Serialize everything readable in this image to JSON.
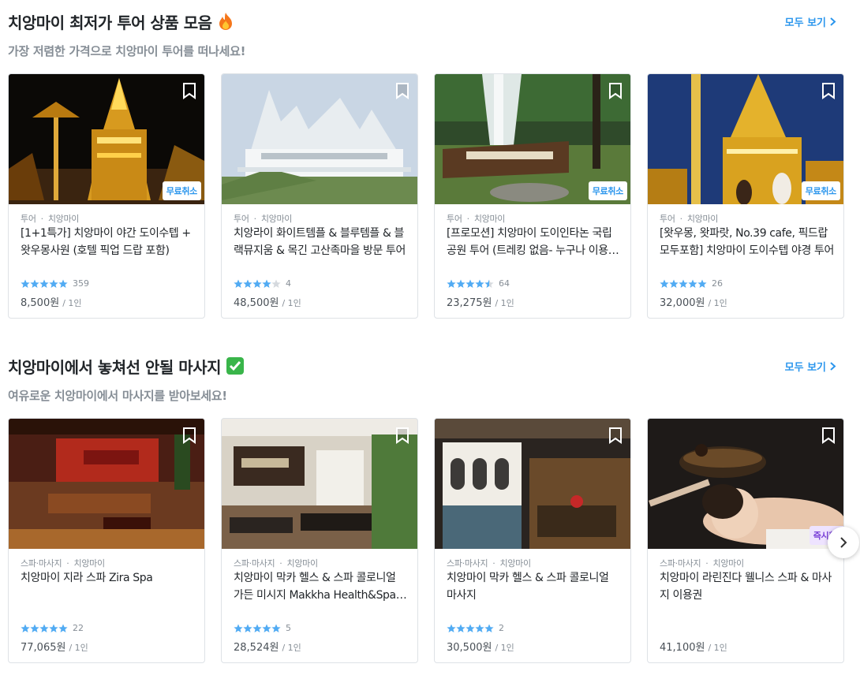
{
  "sections": [
    {
      "title": "치앙마이 최저가 투어 상품 모음",
      "title_icon": "fire-emoji",
      "subtitle": "가장 저렴한 가격으로 치앙마이 투어를 떠나세요!",
      "see_all": "모두 보기",
      "cards": [
        {
          "category": "투어",
          "city": "치앙마이",
          "title": "[1+1특가] 치앙마이 야간 도이수텝 + 왓우몽사원 (호텔 픽업 드랍 포함)",
          "rating": 5,
          "reviews": "359",
          "price": "8,500원",
          "unit": "/ 1인",
          "badge": "무료취소",
          "image": "golden-temple-night"
        },
        {
          "category": "투어",
          "city": "치앙마이",
          "title": "치앙라이 화이트템플 & 블루템플 & 블랙뮤지움 & 목긴 고산족마을 방문 투어",
          "rating": 4,
          "reviews": "4",
          "price": "48,500원",
          "unit": "/ 1인",
          "badge": "",
          "image": "white-temple"
        },
        {
          "category": "투어",
          "city": "치앙마이",
          "title": "[프로모션] 치앙마이 도이인타논 국립 공원 투어 (트레킹 없음- 누구나 이용 가능)",
          "rating": 4.5,
          "reviews": "64",
          "price": "23,275원",
          "unit": "/ 1인",
          "badge": "무료취소",
          "image": "waterfall"
        },
        {
          "category": "투어",
          "city": "치앙마이",
          "title": "[왓우몽, 왓파랏, No.39 cafe, 픽드랍 모두포함] 치앙마이 도이수텝 야경 투어",
          "rating": 5,
          "reviews": "26",
          "price": "32,000원",
          "unit": "/ 1인",
          "badge": "무료취소",
          "image": "golden-pagoda"
        }
      ]
    },
    {
      "title": "치앙마이에서 놓쳐선 안될 마사지",
      "title_icon": "check-emoji",
      "subtitle": "여유로운 치앙마이에서 마사지를 받아보세요!",
      "see_all": "모두 보기",
      "cards": [
        {
          "category": "스파·마사지",
          "city": "치앙마이",
          "title": "치앙마이 지라 스파 Zira Spa",
          "rating": 5,
          "reviews": "22",
          "price": "77,065원",
          "unit": "/ 1인",
          "badge": "",
          "image": "zira-spa-lobby"
        },
        {
          "category": "스파·마사지",
          "city": "치앙마이",
          "title": "치앙마이 막카 헬스 & 스파 콜로니얼 가든 미시지 Makkha Health&Spa Colonial Garden",
          "rating": 5,
          "reviews": "5",
          "price": "28,524원",
          "unit": "/ 1인",
          "badge": "",
          "image": "makkha-lobby"
        },
        {
          "category": "스파·마사지",
          "city": "치앙마이",
          "title": "치앙마이 막카 헬스 & 스파 콜로니얼 마사지",
          "rating": 5,
          "reviews": "2",
          "price": "30,500원",
          "unit": "/ 1인",
          "badge": "",
          "image": "colonial-pool"
        },
        {
          "category": "스파·마사지",
          "city": "치앙마이",
          "title": "치앙마이 라린진다 웰니스 스파 & 마사지 이용권",
          "rating": 0,
          "reviews": "",
          "price": "41,100원",
          "unit": "/ 1인",
          "badge": "즉시확정",
          "image": "singing-bowl"
        }
      ]
    }
  ],
  "icons": {
    "bookmark": "bookmark-icon",
    "star": "star-icon",
    "next": "chevron-right-icon"
  },
  "colors": {
    "accent": "#2b96ed",
    "star": "#51abf3",
    "star_empty": "#d5d9de",
    "badge_purple": "#7a41d8"
  }
}
